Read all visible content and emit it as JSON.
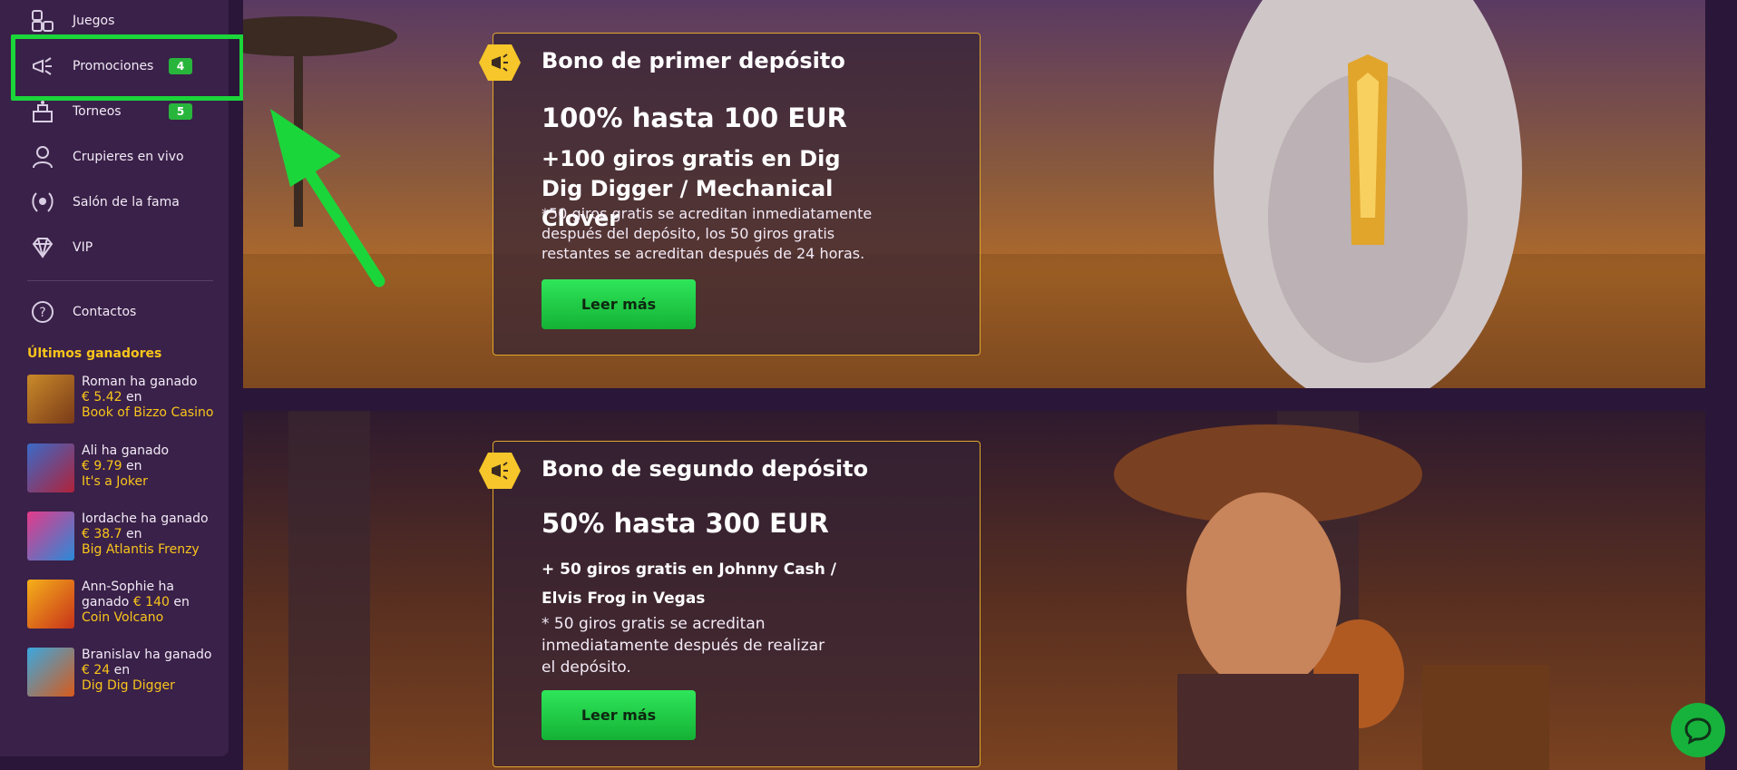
{
  "sidebar": {
    "items": [
      {
        "label": "Juegos",
        "icon": "games-icon"
      },
      {
        "label": "Promociones",
        "icon": "megaphone-icon",
        "badge": "4"
      },
      {
        "label": "Torneos",
        "icon": "tournament-icon",
        "badge": "5"
      },
      {
        "label": "Crupieres en vivo",
        "icon": "dealer-icon"
      },
      {
        "label": "Salón de la fama",
        "icon": "laurel-icon"
      },
      {
        "label": "VIP",
        "icon": "diamond-icon"
      }
    ],
    "contacts": {
      "label": "Contactos",
      "icon": "help-icon"
    },
    "winners_title": "Últimos ganadores",
    "winners": [
      {
        "line1": "Roman ha ganado",
        "amount": "€ 5.42",
        "suffix": " en",
        "game": "Book of Bizzo Casino"
      },
      {
        "line1": "Ali ha ganado",
        "amount": "€ 9.79",
        "suffix": " en",
        "game": "It's a Joker"
      },
      {
        "line1": "Iordache ha ganado",
        "amount": "€ 38.7",
        "suffix": " en",
        "game": "Big Atlantis Frenzy"
      },
      {
        "line1": "Ann-Sophie ha ganado",
        "amount": "€ 140",
        "suffix": " en",
        "game": "Coin Volcano"
      },
      {
        "line1": "Branislav ha ganado",
        "amount": "€ 24",
        "suffix": " en",
        "game": "Dig Dig Digger"
      }
    ]
  },
  "promos": [
    {
      "title": "Bono de primer depósito",
      "headline": "100% hasta 100 EUR",
      "sub": "+100 giros gratis en Dig Dig Digger / Mechanical Clover",
      "note": "*50 giros gratis se acreditan inmediatamente después del depósito, los 50 giros gratis restantes se acreditan después de 24 horas.",
      "button": "Leer más"
    },
    {
      "title": "Bono de segundo depósito",
      "headline": "50% hasta 300 EUR",
      "sub": "+ 50 giros gratis en Johnny Cash /  Elvis Frog in Vegas",
      "note": "* 50 giros gratis se acreditan inmediatamente después de realizar el depósito.",
      "button": "Leer más"
    }
  ],
  "colors": {
    "accent": "#f9c51b",
    "button": "#22c94a",
    "highlight": "#1bd63a"
  }
}
